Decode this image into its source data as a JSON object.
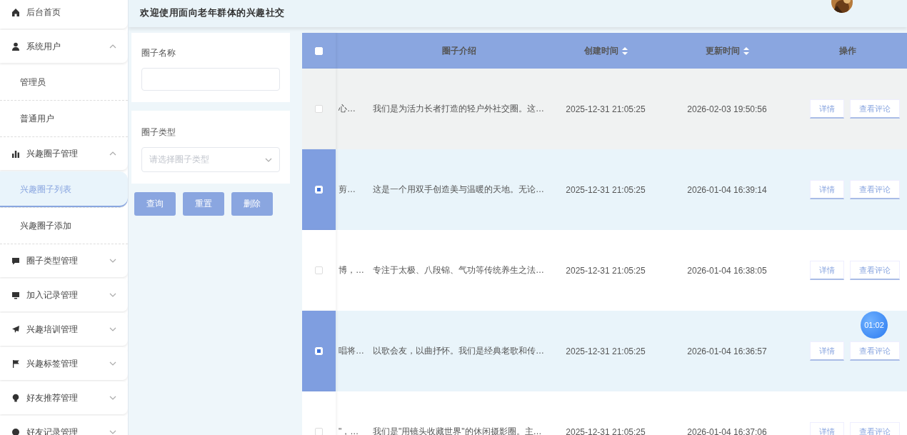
{
  "header": {
    "title": "欢迎使用面向老年群体的兴趣社交"
  },
  "sidebar": {
    "items": [
      {
        "label": "后台首页",
        "kind": "link",
        "selected": false
      },
      {
        "label": "系统用户",
        "kind": "group",
        "expanded": true,
        "children": [
          {
            "label": "管理员",
            "selected": false
          },
          {
            "label": "普通用户",
            "selected": false
          }
        ]
      },
      {
        "label": "兴趣圈子管理",
        "kind": "group",
        "expanded": true,
        "children": [
          {
            "label": "兴趣圈子列表",
            "selected": true
          },
          {
            "label": "兴趣圈子添加",
            "selected": false
          }
        ]
      },
      {
        "label": "圈子类型管理",
        "kind": "group",
        "expanded": false
      },
      {
        "label": "加入记录管理",
        "kind": "group",
        "expanded": false
      },
      {
        "label": "兴趣培训管理",
        "kind": "group",
        "expanded": false
      },
      {
        "label": "兴趣标签管理",
        "kind": "group",
        "expanded": false
      },
      {
        "label": "好友推荐管理",
        "kind": "group",
        "expanded": false
      },
      {
        "label": "好友记录管理",
        "kind": "group",
        "expanded": false
      }
    ]
  },
  "filter": {
    "fields": [
      {
        "kind": "input",
        "label": "圈子名称"
      },
      {
        "kind": "select",
        "label": "圈子类型",
        "placeholder": "请选择圈子类型"
      }
    ],
    "buttons": [
      "查询",
      "重置",
      "删除"
    ]
  },
  "table": {
    "select_all": {
      "checked": false
    },
    "columns": [
      {
        "label": "圈子介绍",
        "sortable": false
      },
      {
        "label": "创建时间",
        "sortable": true
      },
      {
        "label": "更新时间",
        "sortable": true
      },
      {
        "label": "操作",
        "sortable": false
      }
    ],
    "rows": [
      {
        "selected": false,
        "hovered": true,
        "column_2": "心…",
        "intro": "我们是为活力长者打造的轻户外社交圈。这…",
        "created": "2025-12-31 21:05:25",
        "updated": "2026-02-03 19:50:56",
        "actions": [
          "详情",
          "查看评论"
        ]
      },
      {
        "selected": true,
        "hovered": false,
        "column_2": "剪…",
        "intro": "这是一个用双手创造美与温暖的天地。无论…",
        "created": "2025-12-31 21:05:25",
        "updated": "2026-01-04 16:39:14",
        "actions": [
          "详情",
          "查看评论"
        ]
      },
      {
        "selected": false,
        "hovered": false,
        "column_2": "博，…",
        "intro": "专注于太极、八段锦、气功等传统养生之法…",
        "created": "2025-12-31 21:05:25",
        "updated": "2026-01-04 16:38:05",
        "actions": [
          "详情",
          "查看评论"
        ]
      },
      {
        "selected": true,
        "hovered": false,
        "column_2": "唱将…",
        "intro": "以歌会友，以曲抒怀。我们是经典老歌和传…",
        "created": "2025-12-31 21:05:25",
        "updated": "2026-01-04 16:36:57",
        "actions": [
          "详情",
          "查看评论"
        ]
      },
      {
        "selected": false,
        "hovered": false,
        "column_2": "\"，…",
        "intro": "我们是\"用镜头收藏世界\"的休闲摄影圈。主…",
        "created": "2025-12-31 21:05:25",
        "updated": "2026-01-04 16:37:06",
        "actions": [
          "详情",
          "查看评论"
        ]
      }
    ]
  },
  "timer": {
    "text": "01:02"
  }
}
